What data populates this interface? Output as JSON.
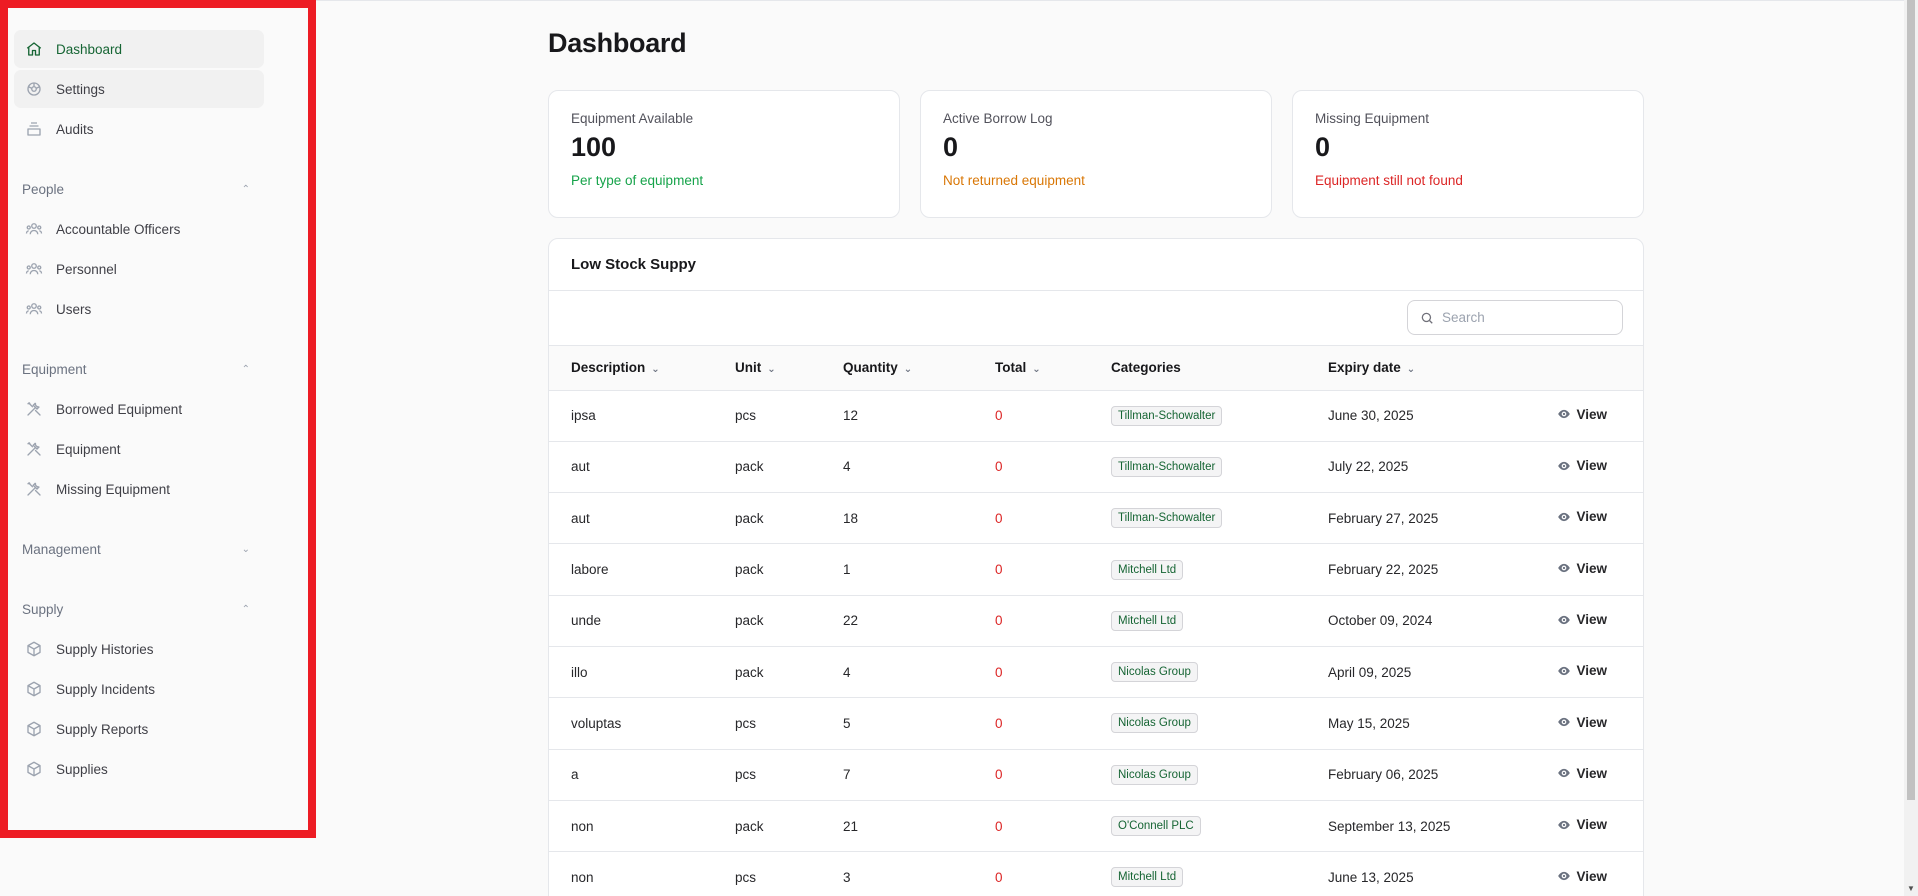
{
  "sidebar": {
    "top_items": [
      {
        "label": "Dashboard",
        "icon": "home-icon",
        "active": true
      },
      {
        "label": "Settings",
        "icon": "gear-icon"
      },
      {
        "label": "Audits",
        "icon": "archive-icon"
      }
    ],
    "groups": [
      {
        "label": "People",
        "expanded": true,
        "items": [
          {
            "label": "Accountable Officers",
            "icon": "users-icon"
          },
          {
            "label": "Personnel",
            "icon": "users-icon"
          },
          {
            "label": "Users",
            "icon": "users-icon"
          }
        ]
      },
      {
        "label": "Equipment",
        "expanded": true,
        "items": [
          {
            "label": "Borrowed Equipment",
            "icon": "tools-icon"
          },
          {
            "label": "Equipment",
            "icon": "tools-icon"
          },
          {
            "label": "Missing Equipment",
            "icon": "tools-icon"
          }
        ]
      },
      {
        "label": "Management",
        "expanded": false,
        "items": []
      },
      {
        "label": "Supply",
        "expanded": true,
        "items": [
          {
            "label": "Supply Histories",
            "icon": "cube-icon"
          },
          {
            "label": "Supply Incidents",
            "icon": "cube-icon"
          },
          {
            "label": "Supply Reports",
            "icon": "cube-icon"
          },
          {
            "label": "Supplies",
            "icon": "cube-icon"
          }
        ]
      }
    ]
  },
  "page": {
    "title": "Dashboard"
  },
  "stats": [
    {
      "label": "Equipment Available",
      "value": "100",
      "desc": "Per type of equipment",
      "color": "#16a34a"
    },
    {
      "label": "Active Borrow Log",
      "value": "0",
      "desc": "Not returned equipment",
      "color": "#d97706"
    },
    {
      "label": "Missing Equipment",
      "value": "0",
      "desc": "Equipment still not found",
      "color": "#dc2626"
    }
  ],
  "table": {
    "title": "Low Stock Suppy",
    "search_placeholder": "Search",
    "columns": [
      "Description",
      "Unit",
      "Quantity",
      "Total",
      "Categories",
      "Expiry date"
    ],
    "action_label": "View",
    "rows": [
      {
        "description": "ipsa",
        "unit": "pcs",
        "quantity": "12",
        "total": "0",
        "category": "Tillman-Schowalter",
        "expiry": "June 30, 2025"
      },
      {
        "description": "aut",
        "unit": "pack",
        "quantity": "4",
        "total": "0",
        "category": "Tillman-Schowalter",
        "expiry": "July 22, 2025"
      },
      {
        "description": "aut",
        "unit": "pack",
        "quantity": "18",
        "total": "0",
        "category": "Tillman-Schowalter",
        "expiry": "February 27, 2025"
      },
      {
        "description": "labore",
        "unit": "pack",
        "quantity": "1",
        "total": "0",
        "category": "Mitchell Ltd",
        "expiry": "February 22, 2025"
      },
      {
        "description": "unde",
        "unit": "pack",
        "quantity": "22",
        "total": "0",
        "category": "Mitchell Ltd",
        "expiry": "October 09, 2024"
      },
      {
        "description": "illo",
        "unit": "pack",
        "quantity": "4",
        "total": "0",
        "category": "Nicolas Group",
        "expiry": "April 09, 2025"
      },
      {
        "description": "voluptas",
        "unit": "pcs",
        "quantity": "5",
        "total": "0",
        "category": "Nicolas Group",
        "expiry": "May 15, 2025"
      },
      {
        "description": "a",
        "unit": "pcs",
        "quantity": "7",
        "total": "0",
        "category": "Nicolas Group",
        "expiry": "February 06, 2025"
      },
      {
        "description": "non",
        "unit": "pack",
        "quantity": "21",
        "total": "0",
        "category": "O'Connell PLC",
        "expiry": "September 13, 2025"
      },
      {
        "description": "non",
        "unit": "pcs",
        "quantity": "3",
        "total": "0",
        "category": "Mitchell Ltd",
        "expiry": "June 13, 2025"
      }
    ]
  }
}
